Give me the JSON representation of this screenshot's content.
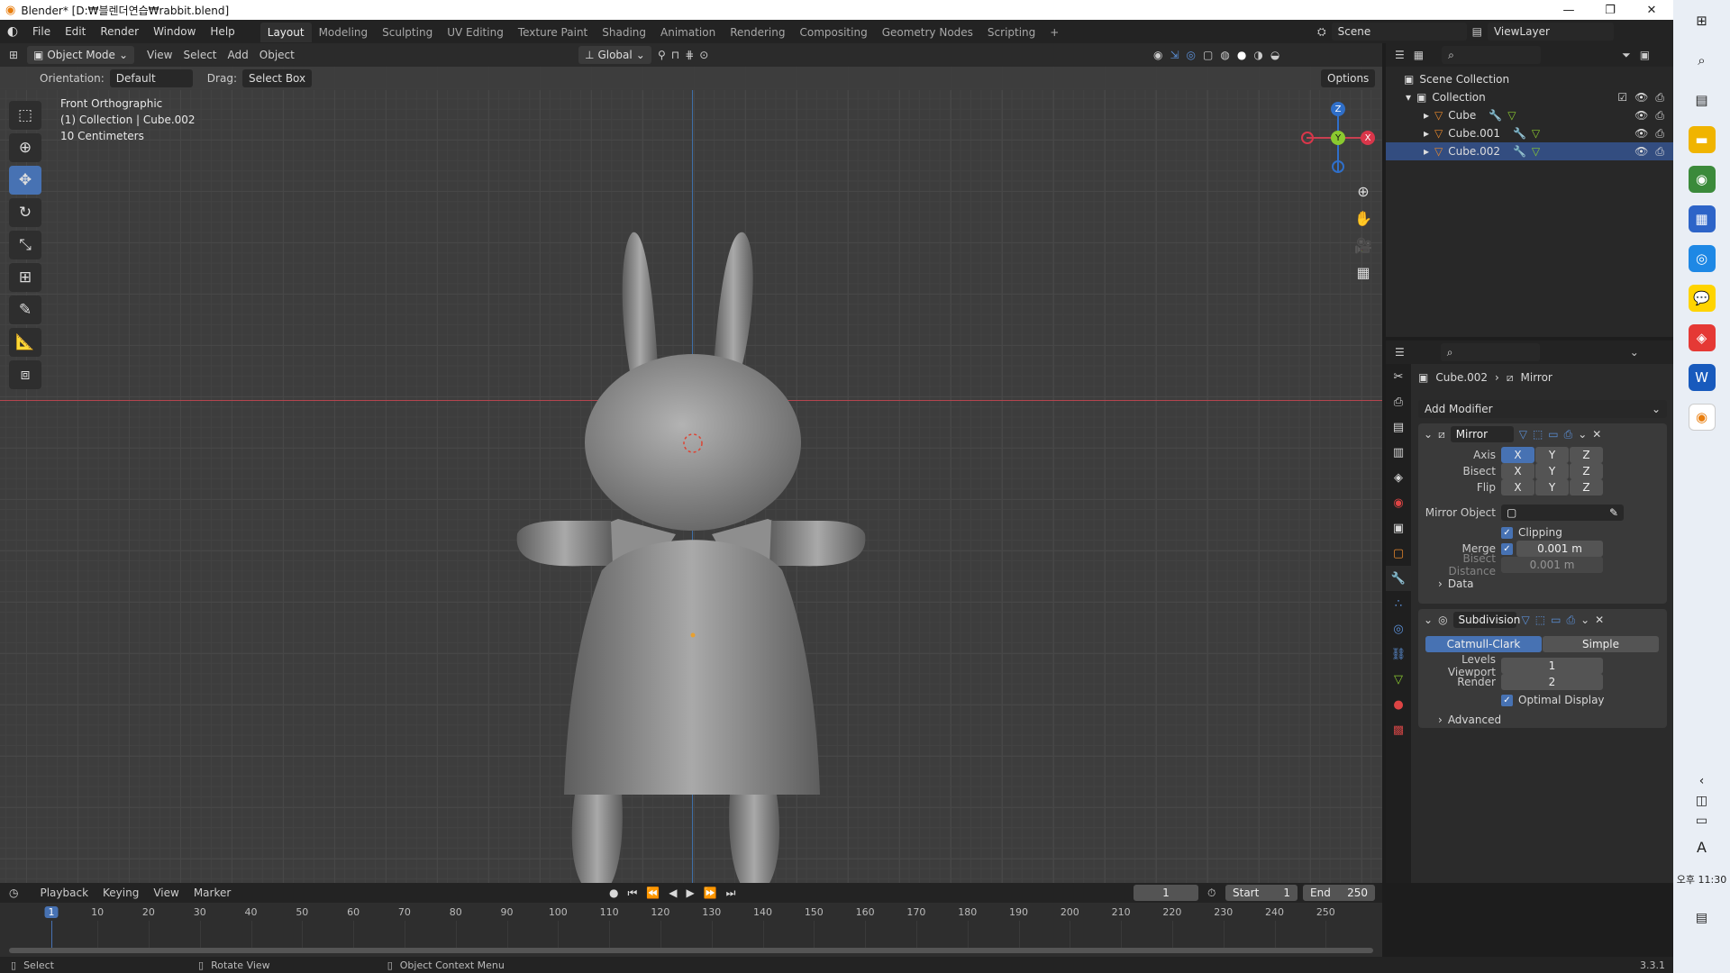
{
  "window": {
    "title": "Blender* [D:₩블렌더연습₩rabbit.blend]",
    "minimize": "—",
    "restore": "❐",
    "close": "✕"
  },
  "menu": [
    "File",
    "Edit",
    "Render",
    "Window",
    "Help"
  ],
  "workspaces": [
    "Layout",
    "Modeling",
    "Sculpting",
    "UV Editing",
    "Texture Paint",
    "Shading",
    "Animation",
    "Rendering",
    "Compositing",
    "Geometry Nodes",
    "Scripting",
    "+"
  ],
  "scene": {
    "label": "Scene",
    "view_layer": "ViewLayer"
  },
  "viewport": {
    "mode": "Object Mode",
    "menus": [
      "View",
      "Select",
      "Add",
      "Object"
    ],
    "transform_orientation": "Global",
    "orientation_label": "Orientation:",
    "orientation_value": "Default",
    "drag_label": "Drag:",
    "drag_value": "Select Box",
    "options": "Options",
    "overlay_line1": "Front Orthographic",
    "overlay_line2": "(1) Collection | Cube.002",
    "overlay_line3": "10 Centimeters",
    "gizmo": {
      "z": "Z",
      "y": "Y",
      "x": "X"
    }
  },
  "outliner": {
    "scene_collection": "Scene Collection",
    "collection": "Collection",
    "objects": [
      "Cube",
      "Cube.001",
      "Cube.002"
    ]
  },
  "properties": {
    "breadcrumb_object": "Cube.002",
    "breadcrumb_modifier": "Mirror",
    "add_modifier": "Add Modifier",
    "mirror": {
      "name": "Mirror",
      "axis_label": "Axis",
      "bisect_label": "Bisect",
      "flip_label": "Flip",
      "axes": [
        "X",
        "Y",
        "Z"
      ],
      "mirror_object_label": "Mirror Object",
      "clipping": "Clipping",
      "merge_label": "Merge",
      "merge_value": "0.001 m",
      "bisect_distance_label": "Bisect Distance",
      "bisect_distance_value": "0.001 m",
      "data": "Data"
    },
    "subdivision": {
      "name": "Subdivision",
      "catmull": "Catmull-Clark",
      "simple": "Simple",
      "levels_viewport_label": "Levels Viewport",
      "levels_viewport": "1",
      "render_label": "Render",
      "render": "2",
      "optimal_display": "Optimal Display",
      "advanced": "Advanced"
    }
  },
  "timeline": {
    "menus": [
      "Playback",
      "Keying",
      "View",
      "Marker"
    ],
    "current_frame": "1",
    "start_label": "Start",
    "start": "1",
    "end_label": "End",
    "end": "250",
    "ticks": [
      "1",
      "10",
      "20",
      "30",
      "40",
      "50",
      "60",
      "70",
      "80",
      "90",
      "100",
      "110",
      "120",
      "130",
      "140",
      "150",
      "160",
      "170",
      "180",
      "190",
      "200",
      "210",
      "220",
      "230",
      "240",
      "250"
    ]
  },
  "status": {
    "select": "Select",
    "rotate": "Rotate View",
    "context": "Object Context Menu",
    "version": "3.3.1"
  },
  "taskbar": {
    "time": "오후 11:30",
    "ime": "A"
  },
  "colors": {
    "accent": "#4772b3",
    "axis_x": "#d9364a",
    "axis_y": "#8ac92f",
    "axis_z": "#2f6fc9"
  }
}
